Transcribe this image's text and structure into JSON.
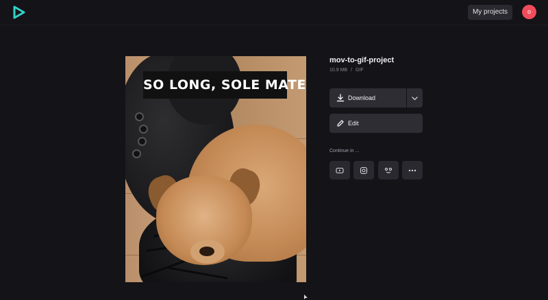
{
  "header": {
    "logo_icon": "play-logo-icon",
    "my_projects_label": "My projects",
    "avatar_initial": "o",
    "avatar_color": "#f04c5a",
    "logo_color": "#2fd3c8"
  },
  "preview": {
    "caption": "SO LONG, SOLE MATE!"
  },
  "project": {
    "title": "mov-to-gif-project",
    "size": "10.9 MB",
    "separator": "/",
    "format": "GIF"
  },
  "actions": {
    "download_label": "Download",
    "download_icon": "download-icon",
    "dropdown_icon": "chevron-down-icon",
    "edit_label": "Edit",
    "edit_icon": "pencil-icon"
  },
  "continue_in": {
    "label": "Continue in ...",
    "targets": [
      {
        "icon": "youtube-icon"
      },
      {
        "icon": "instagram-icon"
      },
      {
        "icon": "share-icon"
      },
      {
        "icon": "more-icon"
      }
    ]
  }
}
